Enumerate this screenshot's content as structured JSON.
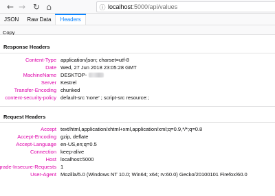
{
  "browser": {
    "url_host": "localhost",
    "url_path": ":5000/api/values",
    "icons": [
      "back-arrow-icon",
      "forward-arrow-icon",
      "reload-icon",
      "home-icon",
      "info-icon"
    ]
  },
  "tabs": [
    {
      "label": "JSON"
    },
    {
      "label": "Raw Data"
    },
    {
      "label": "Headers"
    }
  ],
  "active_tab": "Headers",
  "toolbar": {
    "copy_label": "Copy"
  },
  "response": {
    "title": "Response Headers",
    "headers": [
      {
        "name": "Content-Type",
        "value": "application/json; charset=utf-8"
      },
      {
        "name": "Date",
        "value": "Wed, 27 Jun 2018 23:05:28 GMT"
      },
      {
        "name": "MachineName",
        "value": "DESKTOP-"
      },
      {
        "name": "Server",
        "value": "Kestrel"
      },
      {
        "name": "Transfer-Encoding",
        "value": "chunked"
      },
      {
        "name": "content-security-policy",
        "value": "default-src 'none' ; script-src resource:;"
      }
    ]
  },
  "request": {
    "title": "Request Headers",
    "headers": [
      {
        "name": "Accept",
        "value": "text/html,application/xhtml+xml,application/xml;q=0.9,*/*;q=0.8"
      },
      {
        "name": "Accept-Encoding",
        "value": "gzip, deflate"
      },
      {
        "name": "Accept-Language",
        "value": "en-US,en;q=0.5"
      },
      {
        "name": "Connection",
        "value": "keep-alive"
      },
      {
        "name": "Host",
        "value": "localhost:5000"
      },
      {
        "name": "Upgrade-Insecure-Requests",
        "value": "1"
      },
      {
        "name": "User-Agent",
        "value": "Mozilla/5.0 (Windows NT 10.0; Win64; x64; rv:60.0) Gecko/20100101 Firefox/60.0"
      }
    ]
  },
  "colors": {
    "header_name": "#dd00a9",
    "active_tab": "#0a84ff"
  }
}
